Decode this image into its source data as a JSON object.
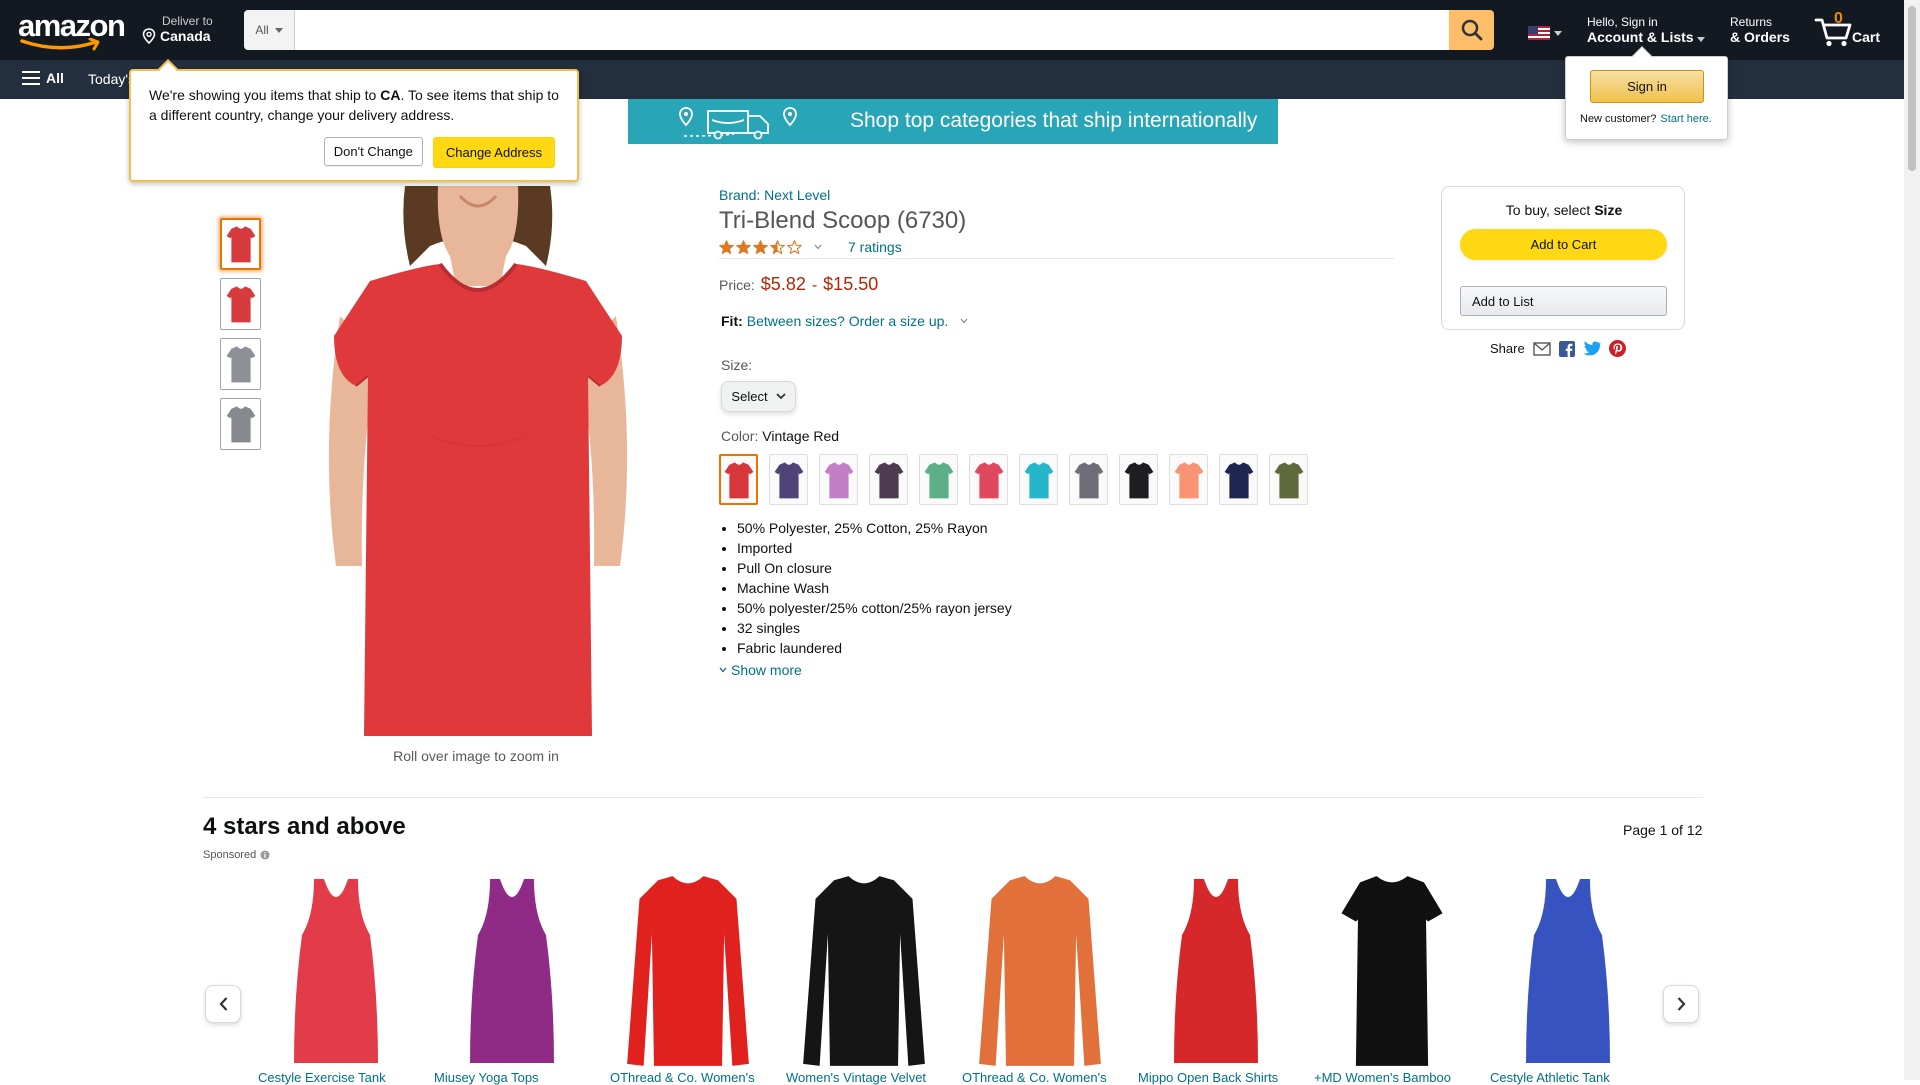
{
  "header": {
    "logo_text": "amazon",
    "deliver_to": "Deliver to",
    "deliver_location": "Canada",
    "search_category": "All",
    "search_placeholder": "",
    "account_greeting": "Hello, Sign in",
    "account_label": "Account & Lists",
    "returns_line1": "Returns",
    "returns_line2": "& Orders",
    "cart_count": "0",
    "cart_label": "Cart"
  },
  "subnav": {
    "all_label": "All",
    "today_label": "Today's Deals"
  },
  "banner": {
    "text": "Shop top categories that ship internationally"
  },
  "deliver_popover": {
    "text_before": "We're showing you items that ship to ",
    "country": "CA",
    "text_after": ". To see items that ship to a different country, change your delivery address.",
    "dont_change": "Don't Change",
    "change_address": "Change Address"
  },
  "signin_popover": {
    "button": "Sign in",
    "new_customer": "New customer?",
    "start_here": "Start here."
  },
  "product": {
    "brand": "Brand: Next Level",
    "title": "Tri-Blend Scoop (6730)",
    "rating_stars": 3.5,
    "ratings_count": "7 ratings",
    "price_label": "Price:",
    "price_low": "$5.82",
    "price_sep": "-",
    "price_high": "$15.50",
    "fit_label": "Fit:",
    "fit_text": "Between sizes? Order a size up.",
    "size_label": "Size:",
    "size_select": "Select",
    "color_label": "Color:",
    "color_value": "Vintage Red",
    "zoom_hint": "Roll over image to zoom in",
    "thumb_colors": [
      "#D63A3D",
      "#D83B3E",
      "#8D9096",
      "#86898E"
    ],
    "main_color": "#E0393C",
    "swatch_colors": [
      "#D5373A",
      "#4F4477",
      "#C27FC8",
      "#4E3B52",
      "#5CAF86",
      "#E0485E",
      "#25B6CC",
      "#6D6E78",
      "#1E1E22",
      "#F89373",
      "#1E2650",
      "#5E6A3C"
    ],
    "bullets": [
      "50% Polyester, 25% Cotton, 25% Rayon",
      "Imported",
      "Pull On closure",
      "Machine Wash",
      "50% polyester/25% cotton/25% rayon jersey",
      "32 singles",
      "Fabric laundered"
    ],
    "show_more": "Show more"
  },
  "buybox": {
    "text_before": "To buy, select ",
    "text_bold": "Size",
    "add_to_cart": "Add to Cart",
    "add_to_list": "Add to List",
    "share_label": "Share"
  },
  "carousel": {
    "title": "4 stars and above",
    "sponsored": "Sponsored",
    "page_label": "Page 1 of 12",
    "items": [
      {
        "name": "Cestyle Exercise Tank",
        "color": "#E23B4A",
        "kind": "tank"
      },
      {
        "name": "Miusey Yoga Tops",
        "color": "#8F2A86",
        "kind": "tank"
      },
      {
        "name": "OThread & Co. Women's",
        "color": "#E0211D",
        "kind": "longsleeve"
      },
      {
        "name": "Women's Vintage Velvet",
        "color": "#151515",
        "kind": "longsleeve"
      },
      {
        "name": "OThread & Co. Women's",
        "color": "#E2703A",
        "kind": "longsleeve"
      },
      {
        "name": "Mippo Open Back Shirts",
        "color": "#D6282B",
        "kind": "tank"
      },
      {
        "name": "+MD Women's Bamboo",
        "color": "#111111",
        "kind": "tee"
      },
      {
        "name": "Cestyle Athletic Tank",
        "color": "#3653C0",
        "kind": "tank"
      }
    ]
  },
  "colors": {
    "nav_dark": "#131921",
    "nav_sub": "#232F3E",
    "search_button": "#FEBD69",
    "cart_count": "#F08804",
    "banner": "#28A5B7",
    "price": "#B12704",
    "link": "#007185",
    "cta_yellow": "#FFD814"
  }
}
